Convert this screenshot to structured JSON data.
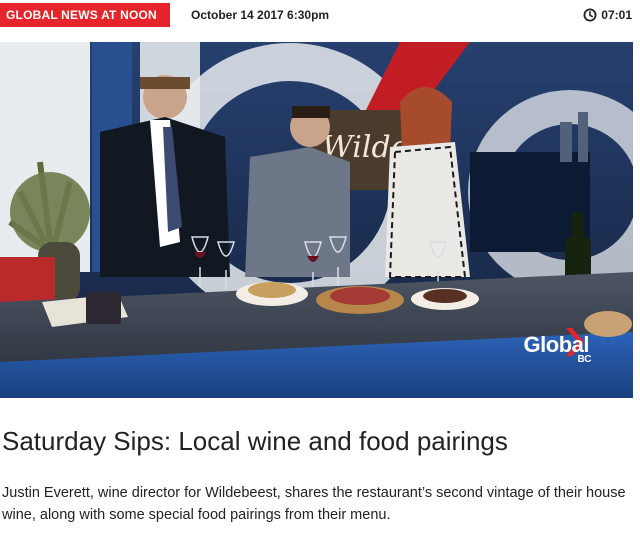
{
  "header": {
    "show_tag": "GLOBAL NEWS AT NOON BC",
    "datetime": "October 14 2017 6:30pm",
    "duration": "07:01",
    "duration_icon": "clock-icon"
  },
  "video": {
    "backdrop_text": "Wilde",
    "logo_text": "Global",
    "logo_sub": "BC"
  },
  "article": {
    "title": "Saturday Sips: Local wine and food pairings",
    "description": "Justin Everett, wine director for Wildebeest, shares the restaurant’s second vintage of their house wine, along with some special food pairings from their menu."
  },
  "colors": {
    "tag_red": "#e5252b",
    "studio_blue": "#1e2f4c"
  }
}
